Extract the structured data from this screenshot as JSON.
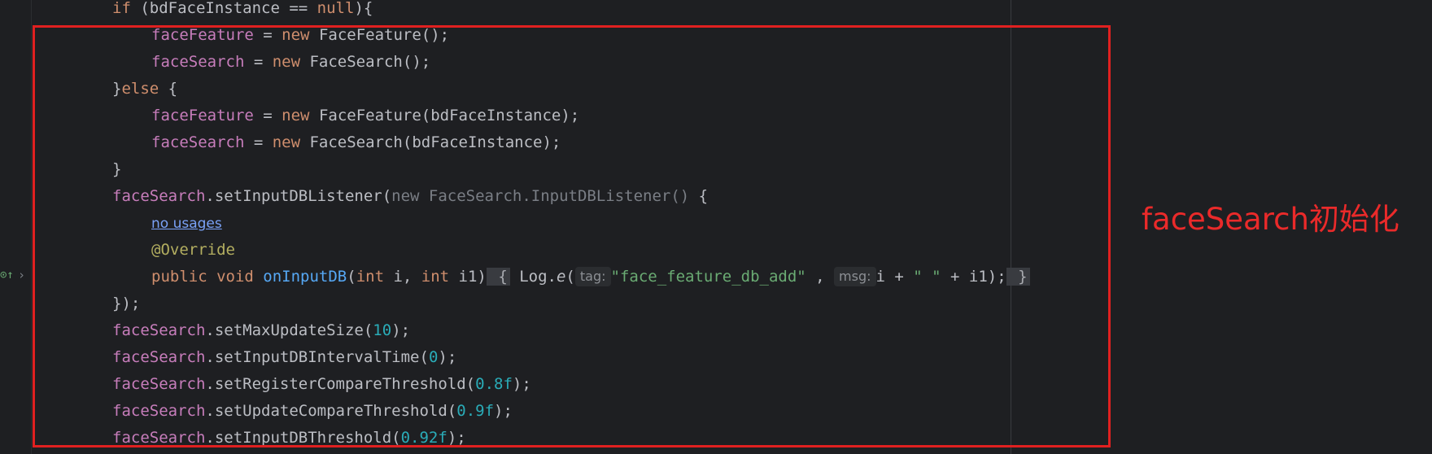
{
  "code": {
    "l1": {
      "a": "if (bdFaceInstance == ",
      "b": "null",
      "c": "){"
    },
    "l2": {
      "a": "faceFeature",
      "b": " = ",
      "c": "new",
      "d": " FaceFeature();"
    },
    "l3": {
      "a": "faceSearch",
      "b": " = ",
      "c": "new",
      "d": " FaceSearch();"
    },
    "l4": {
      "a": "}",
      "b": "else",
      "c": " {"
    },
    "l5": {
      "a": "faceFeature",
      "b": " = ",
      "c": "new",
      "d": " FaceFeature(bdFaceInstance);"
    },
    "l6": {
      "a": "faceSearch",
      "b": " = ",
      "c": "new",
      "d": " FaceSearch(bdFaceInstance);"
    },
    "l7": {
      "a": "}"
    },
    "l8": {
      "a": "faceSearch",
      "b": ".setInputDBListener(",
      "c": "new FaceSearch.InputDBListener()",
      "d": " {"
    },
    "l9": {
      "a": "no usages"
    },
    "l10": {
      "a": "@Override"
    },
    "l11": {
      "a": "public void ",
      "b": "onInputDB",
      "c": "(",
      "d": "int",
      " e": "",
      "e": " i, ",
      "f": "int",
      "g": " i1)",
      "h": " {",
      "i": " Log.",
      "j": "e",
      "k": "(",
      "hint_tag": "tag:",
      "l": "\"face_feature_db_add\"",
      "m": " , ",
      "hint_msg": "msg:",
      "n": "i + ",
      "o": "\" \"",
      "p": " + i1);",
      "q": " }"
    },
    "l12": {
      "a": "});"
    },
    "l13": {
      "a": "faceSearch",
      "b": ".setMaxUpdateSize(",
      "c": "10",
      "d": ");"
    },
    "l14": {
      "a": "faceSearch",
      "b": ".setInputDBIntervalTime(",
      "c": "0",
      "d": ");"
    },
    "l15": {
      "a": "faceSearch",
      "b": ".setRegisterCompareThreshold(",
      "c": "0.8f",
      "d": ");"
    },
    "l16": {
      "a": "faceSearch",
      "b": ".setUpdateCompareThreshold(",
      "c": "0.9f",
      "d": ");"
    },
    "l17": {
      "a": "faceSearch",
      "b": ".setInputDBThreshold(",
      "c": "0.92f",
      "d": ");"
    }
  },
  "gutter": {
    "icon": "implements-icon",
    "icon_glyph": "⊙↑",
    "chevron": "›"
  },
  "annotation": {
    "label": "faceSearch初始化",
    "color": "#ea2a2a"
  },
  "colors": {
    "background": "#1e1f22",
    "keyword": "#cf8e6d",
    "field": "#c77dbb",
    "number": "#2aacb8",
    "string": "#6aab73",
    "highlight_box": "#e02020"
  }
}
